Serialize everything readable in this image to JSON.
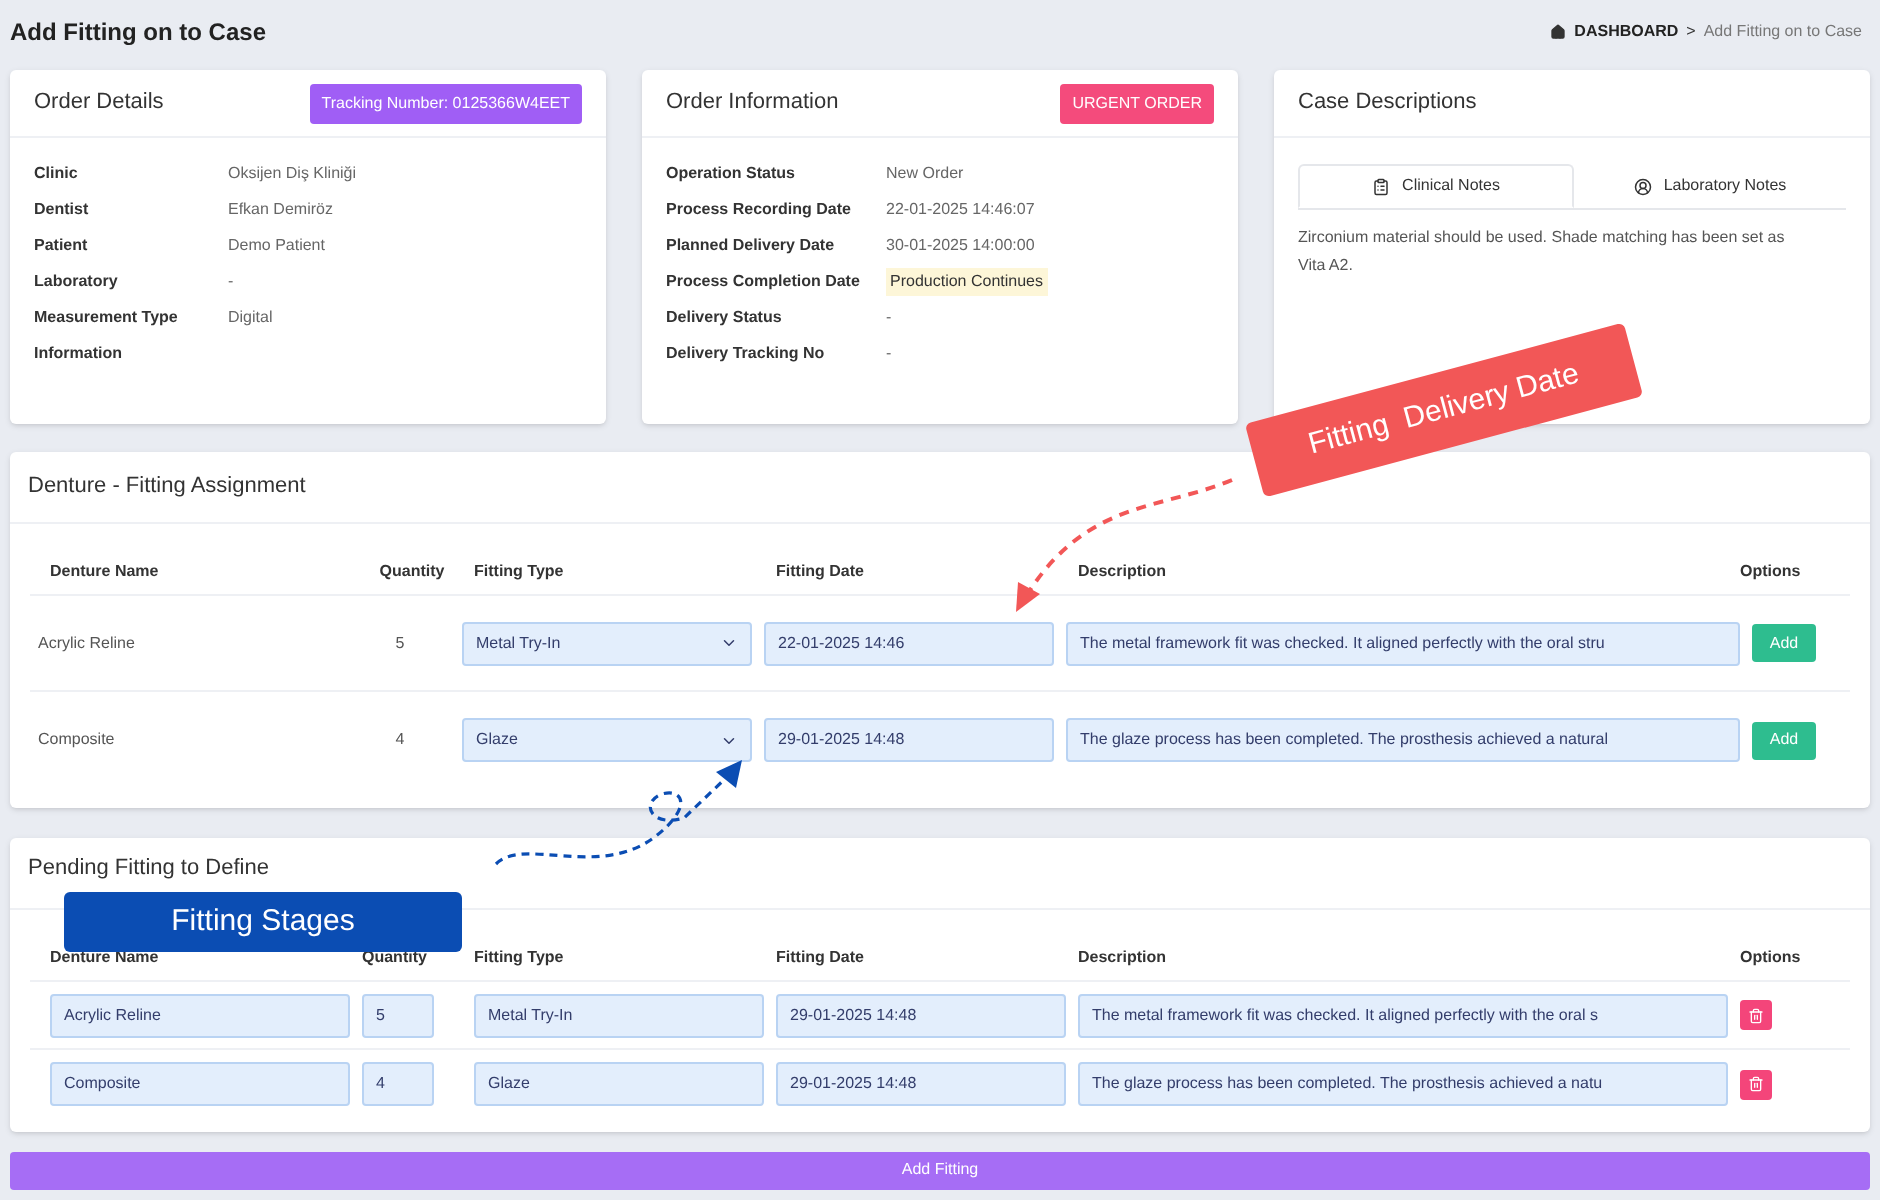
{
  "page": {
    "title": "Add Fitting on to Case",
    "breadcrumb": {
      "items": [
        "DASHBOARD",
        "Add Fitting on to Case"
      ],
      "separator": ">"
    }
  },
  "order_details": {
    "title": "Order Details",
    "badge": "Tracking Number: 0125366W4EET",
    "rows": [
      {
        "label": "Clinic",
        "value": "Oksijen Diş Kliniği"
      },
      {
        "label": "Dentist",
        "value": "Efkan Demiröz"
      },
      {
        "label": "Patient",
        "value": "Demo Patient"
      },
      {
        "label": "Laboratory",
        "value": "-"
      },
      {
        "label": "Measurement Type",
        "value": "Digital"
      },
      {
        "label": "Information"
      }
    ]
  },
  "order_information": {
    "title": "Order Information",
    "badge": "URGENT ORDER",
    "rows": [
      {
        "label": "Operation Status",
        "value": "New Order",
        "kind": "text"
      },
      {
        "label": "Process Recording Date",
        "value": "22-01-2025 14:46:07",
        "kind": "text"
      },
      {
        "label": "Planned Delivery Date",
        "value": "30-01-2025 14:00:00",
        "kind": "text"
      },
      {
        "label": "Process Completion Date",
        "value": "Production Continues",
        "kind": "highlight"
      },
      {
        "label": "Delivery Status",
        "value": "-",
        "kind": "text"
      },
      {
        "label": "Delivery Tracking No",
        "value": "-",
        "kind": "text"
      }
    ]
  },
  "case_descriptions": {
    "title": "Case Descriptions",
    "tabs": [
      {
        "label": "Clinical Notes",
        "selected": true,
        "kind": "clinical"
      },
      {
        "label": "Laboratory Notes",
        "selected": false,
        "kind": "laboratory"
      }
    ],
    "text": "Zirconium material should be used. Shade matching has been set as Vita A2."
  },
  "fitting_assignment": {
    "title": "Denture - Fitting Assignment",
    "columns": [
      "Denture Name",
      "Quantity",
      "Fitting Type",
      "Fitting Date",
      "Description",
      "Options"
    ],
    "rows": [
      {
        "denture_name": "Acrylic Reline",
        "quantity": "5",
        "fitting_type": "Metal Try-In",
        "fitting_date": "22-01-2025 14:46",
        "description": "The metal framework fit was checked. It aligned perfectly with the oral stru",
        "action": "Add"
      },
      {
        "denture_name": "Composite",
        "quantity": "4",
        "fitting_type": "Glaze",
        "fitting_date": "29-01-2025 14:48",
        "description": "The glaze process has been completed. The prosthesis achieved a natural",
        "action": "Add"
      }
    ]
  },
  "pending_fittings": {
    "title": "Pending Fitting to Define",
    "columns": [
      "Denture Name",
      "Quantity",
      "Fitting Type",
      "Fitting Date",
      "Description",
      "Options"
    ],
    "rows": [
      {
        "denture_name": "Acrylic Reline",
        "quantity": "5",
        "fitting_type": "Metal Try-In",
        "fitting_date": "29-01-2025 14:48",
        "description": "The metal framework fit was checked. It aligned perfectly with the oral s"
      },
      {
        "denture_name": "Composite",
        "quantity": "4",
        "fitting_type": "Glaze",
        "fitting_date": "29-01-2025 14:48",
        "description": "The glaze process has been completed. The prosthesis achieved a natu"
      }
    ]
  },
  "add_button": "Add Fitting",
  "annotations": [
    {
      "text": "Fitting  Delivery Date",
      "color": "#f25757",
      "kind": "delivery"
    },
    {
      "text": "Fitting Stages",
      "color": "#0b4db3",
      "kind": "stages"
    }
  ]
}
